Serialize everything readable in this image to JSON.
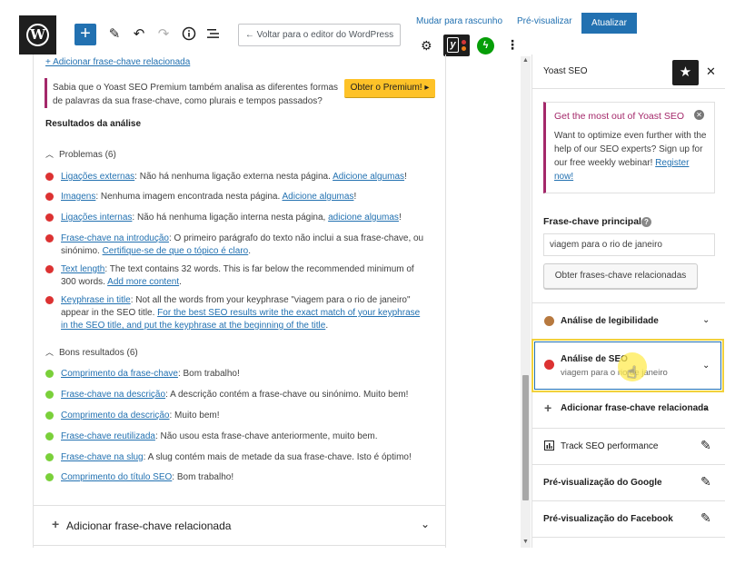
{
  "toolbar": {
    "wp_logo": "W",
    "add_icon": "+",
    "back_button": "← Voltar para o editor do WordPress",
    "switch_draft": "Mudar para rascunho",
    "preview": "Pré-visualizar",
    "update": "Atualizar",
    "yoast_letter": "y"
  },
  "main": {
    "add_related_top": "+ Adicionar frase-chave relacionada",
    "premium_text": "Sabia que o Yoast SEO Premium também analisa as diferentes formas de palavras da sua frase-chave, como plurais e tempos passados?",
    "premium_button": "Obter o Premium! ▸",
    "analysis_title": "Resultados da análise",
    "problems_title": "Problemas (6)",
    "problems": [
      {
        "link": "Ligações externas",
        "text": ": Não há nenhuma ligação externa nesta página. ",
        "link2": "Adicione algumas",
        "end": "!"
      },
      {
        "link": "Imagens",
        "text": ": Nenhuma imagem encontrada nesta página. ",
        "link2": "Adicione algumas",
        "end": "!"
      },
      {
        "link": "Ligações internas",
        "text": ": Não há nenhuma ligação interna nesta página, ",
        "link2": "adicione algumas",
        "end": "!"
      },
      {
        "link": "Frase-chave na introdução",
        "text": ": O primeiro parágrafo do texto não inclui a sua frase-chave, ou sinónimo. ",
        "link2": "Certifique-se de que o tópico é claro",
        "end": "."
      },
      {
        "link": "Text length",
        "text": ": The text contains 32 words. This is far below the recommended minimum of 300 words. ",
        "link2": "Add more content",
        "end": "."
      },
      {
        "link": "Keyphrase in title",
        "text": ": Not all the words from your keyphrase \"viagem para o rio de janeiro\" appear in the SEO title. ",
        "link2": "For the best SEO results write the exact match of your keyphrase in the SEO title, and put the keyphrase at the beginning of the title",
        "end": "."
      }
    ],
    "good_title": "Bons resultados (6)",
    "good": [
      {
        "link": "Comprimento da frase-chave",
        "text": ": Bom trabalho!"
      },
      {
        "link": "Frase-chave na descrição",
        "text": ": A descrição contém a frase-chave ou sinónimo. Muito bem!"
      },
      {
        "link": "Comprimento da descrição",
        "text": ": Muito bem!"
      },
      {
        "link": "Frase-chave reutilizada",
        "text": ": Não usou esta frase-chave anteriormente, muito bem."
      },
      {
        "link": "Frase-chave na slug",
        "text": ": A slug contém mais de metade da sua frase-chave. Isto é óptimo!"
      },
      {
        "link": "Comprimento do título SEO",
        "text": ": Bom trabalho!"
      }
    ],
    "footer_label": "Adicionar frase-chave relacionada"
  },
  "sidebar": {
    "title": "Yoast SEO",
    "promo_title": "Get the most out of Yoast SEO",
    "promo_text": "Want to optimize even further with the help of our SEO experts? Sign up for our free weekly webinar! ",
    "promo_link": "Register now!",
    "focus_label": "Frase-chave principal",
    "focus_value": "viagem para o rio de janeiro",
    "related_button": "Obter frases-chave relacionadas",
    "readability": "Análise de legibilidade",
    "seo_analysis": "Análise de SEO",
    "seo_sub": "viagem para o rio de janeiro",
    "add_related": "Adicionar frase-chave relacionada",
    "track": "Track SEO performance",
    "google_preview": "Pré-visualização do Google",
    "facebook_preview": "Pré-visualização do Facebook"
  }
}
